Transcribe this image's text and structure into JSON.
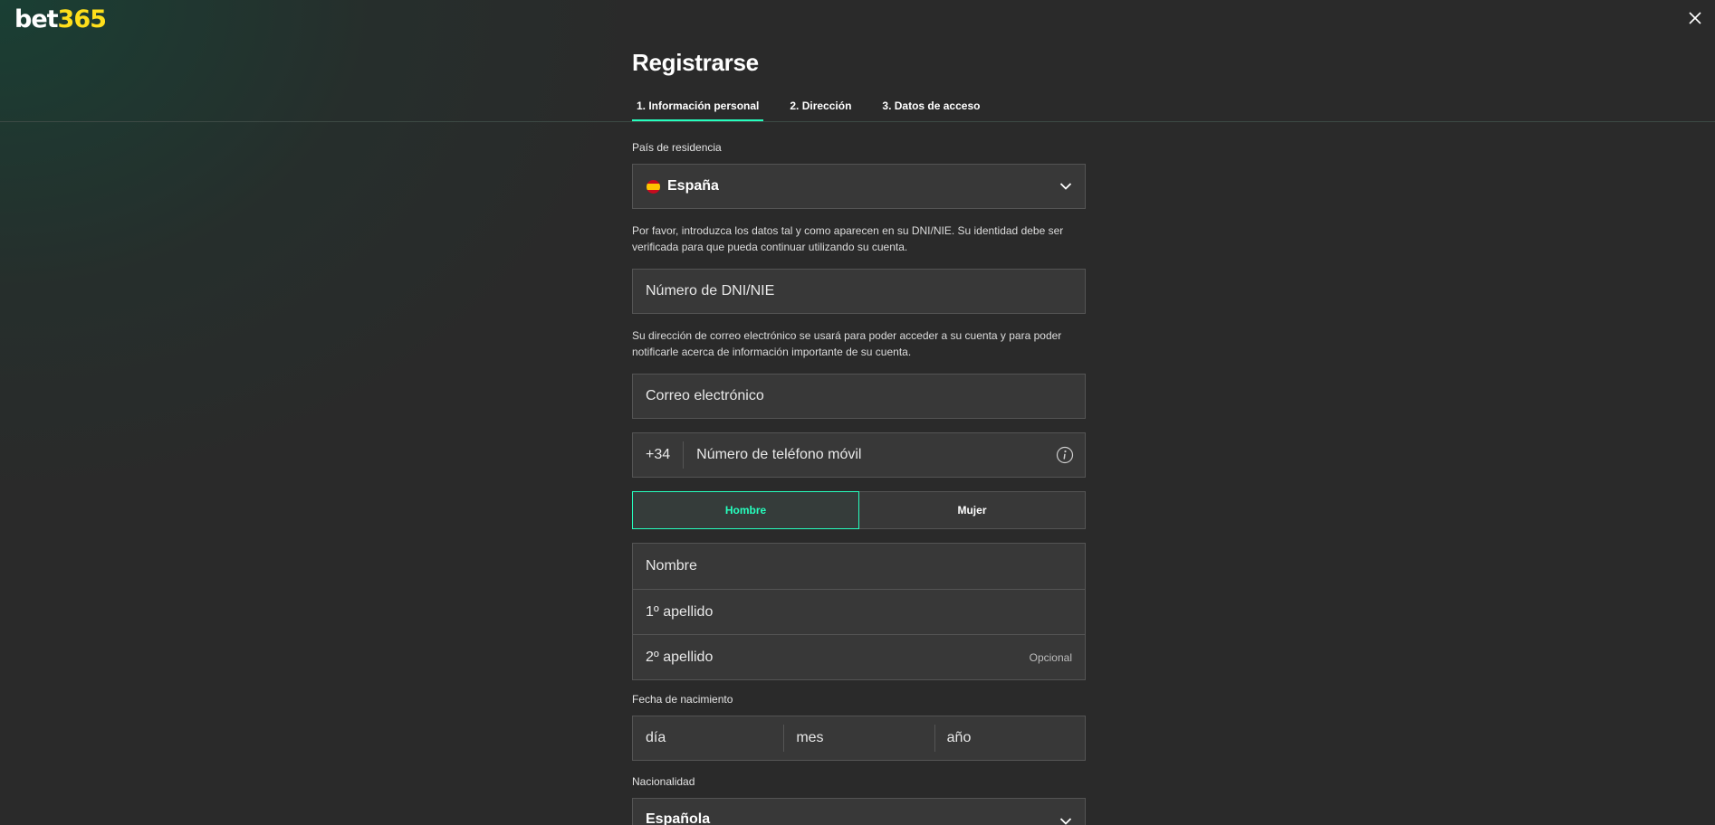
{
  "brand": {
    "part1": "bet",
    "part2": "365",
    "accent": "#ffdf1b"
  },
  "accent_color": "#26ffbe",
  "title": "Registrarse",
  "tabs": [
    {
      "label": "1.  Información personal",
      "active": true
    },
    {
      "label": "2.  Dirección",
      "active": false
    },
    {
      "label": "3.  Datos de acceso",
      "active": false
    }
  ],
  "country": {
    "label": "País de residencia",
    "value": "España"
  },
  "dni_info": "Por favor, introduzca los datos tal y como aparecen en su DNI/NIE. Su identidad debe ser verificada para que pueda continuar utilizando su cuenta.",
  "dni": {
    "placeholder": "Número de DNI/NIE"
  },
  "email_info": "Su dirección de correo electrónico se usará para poder acceder a su cuenta y para poder notificarle acerca de información importante de su cuenta.",
  "email": {
    "placeholder": "Correo electrónico"
  },
  "phone": {
    "prefix": "+34",
    "placeholder": "Número de teléfono móvil",
    "info_icon": "info-icon"
  },
  "gender": {
    "male": "Hombre",
    "female": "Mujer",
    "selected": "Hombre"
  },
  "name": {
    "first": "Nombre",
    "surname1": "1º apellido",
    "surname2": "2º apellido",
    "optional": "Opcional"
  },
  "dob": {
    "label": "Fecha de nacimiento",
    "day": "día",
    "month": "mes",
    "year": "año"
  },
  "nationality": {
    "label": "Nacionalidad",
    "value": "Española"
  }
}
